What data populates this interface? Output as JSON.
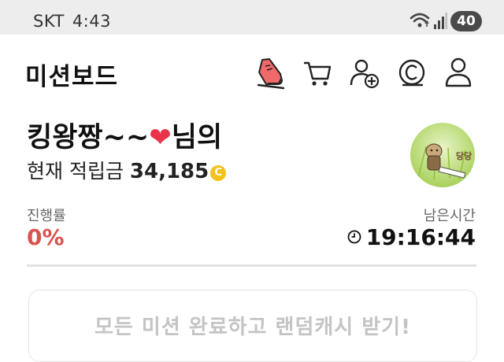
{
  "status_bar": {
    "carrier": "SKT",
    "time": "4:43",
    "battery": "40"
  },
  "header": {
    "title": "미션보드",
    "icons": [
      "walk-shoe-icon",
      "cart-icon",
      "add-user-icon",
      "cash-coin-icon",
      "profile-icon"
    ]
  },
  "user": {
    "name": "킹왕짱~~",
    "suffix": "님의",
    "points_label": "현재 적립금",
    "points_value": "34,185",
    "coin_symbol": "C",
    "avatar_text": "당당"
  },
  "progress": {
    "label": "진행률",
    "value": "0%"
  },
  "timer": {
    "label": "남은시간",
    "value": "19:16:44"
  },
  "mission_banner": {
    "text": "모든 미션 완료하고 랜덤캐시 받기!"
  },
  "colors": {
    "accent_red": "#d9534f",
    "shoe_red": "#f06a6a",
    "coin_yellow": "#f4c21b",
    "muted_text": "#c4c4c4"
  }
}
